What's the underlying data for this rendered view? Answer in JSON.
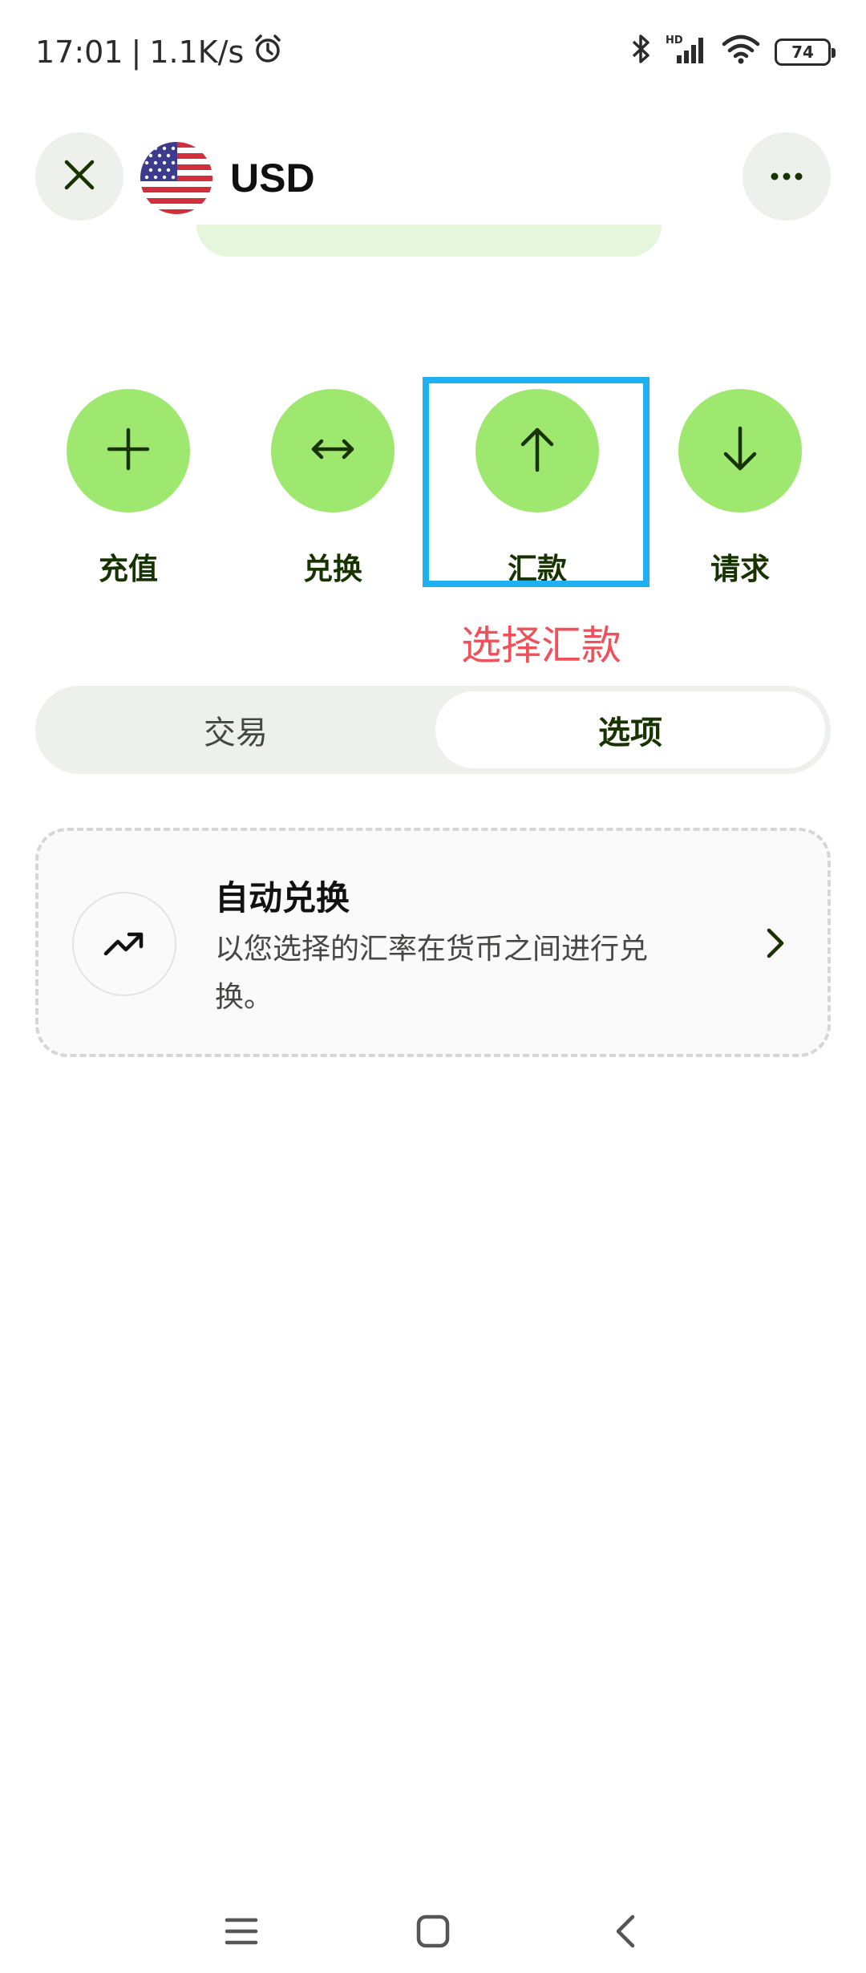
{
  "status_bar": {
    "time": "17:01",
    "separator": "|",
    "network_speed": "1.1K/s",
    "battery_level": "74",
    "icons": [
      "alarm-icon",
      "bluetooth-icon",
      "hd-signal-icon",
      "wifi-icon",
      "battery-icon"
    ]
  },
  "header": {
    "currency": "USD",
    "close_icon": "close-icon",
    "more_icon": "more-horizontal-icon",
    "flag": "us-flag"
  },
  "actions": [
    {
      "label": "充值",
      "icon": "plus-icon"
    },
    {
      "label": "兑换",
      "icon": "swap-arrows-icon"
    },
    {
      "label": "汇款",
      "icon": "arrow-up-icon"
    },
    {
      "label": "请求",
      "icon": "arrow-down-icon"
    }
  ],
  "annotation": "选择汇款",
  "tabs": [
    {
      "label": "交易",
      "active": false
    },
    {
      "label": "选项",
      "active": true
    }
  ],
  "card": {
    "title": "自动兑换",
    "description": "以您选择的汇率在货币之间进行兑换。",
    "icon": "trending-up-icon"
  },
  "colors": {
    "accent_green": "#9fe870",
    "dark_green": "#163300",
    "highlight_blue": "#1fb0f2",
    "annotation_red": "#f0505a"
  }
}
